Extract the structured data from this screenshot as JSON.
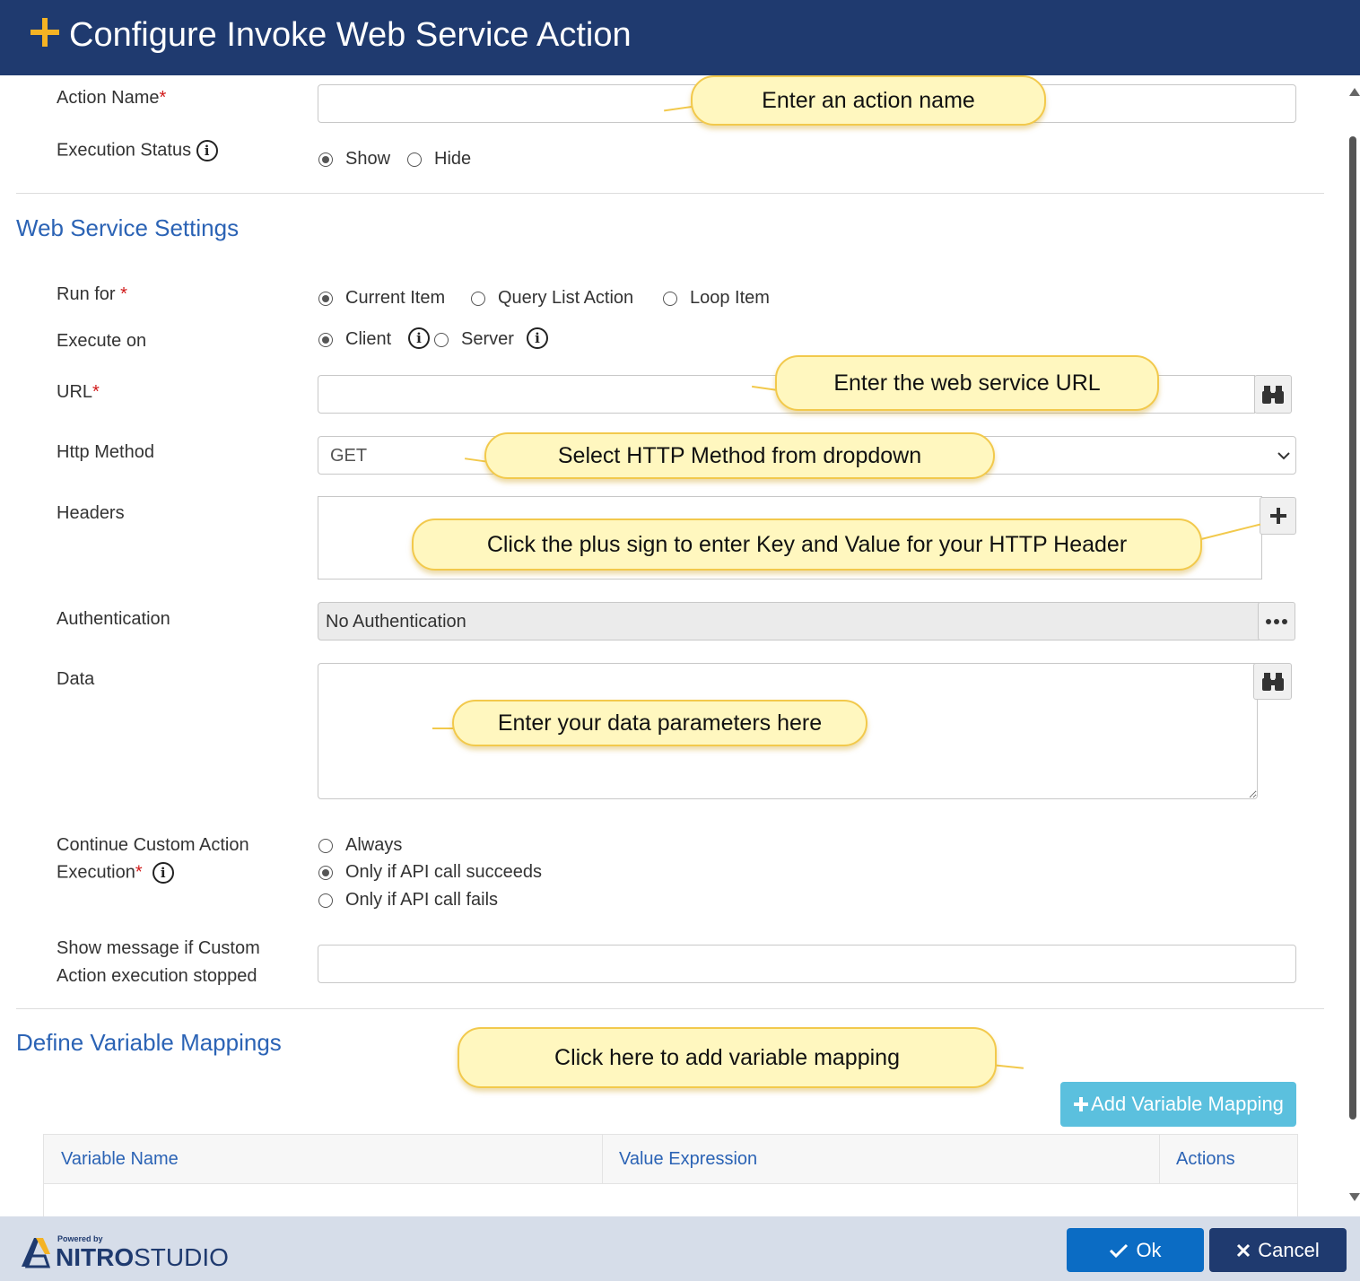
{
  "dialog": {
    "title": "Configure Invoke Web Service Action"
  },
  "action": {
    "name_label": "Action Name",
    "name_value": "",
    "status_label": "Execution Status",
    "status_options": [
      "Show",
      "Hide"
    ],
    "status_selected": "Show"
  },
  "web_service": {
    "section_title": "Web Service Settings",
    "run_for_label": "Run for",
    "run_for_options": [
      "Current Item",
      "Query List Action",
      "Loop Item"
    ],
    "run_for_selected": "Current Item",
    "execute_on_label": "Execute on",
    "execute_on_options": [
      "Client",
      "Server"
    ],
    "execute_on_selected": "Client",
    "url_label": "URL",
    "url_value": "",
    "http_method_label": "Http Method",
    "http_method_value": "GET",
    "headers_label": "Headers",
    "auth_label": "Authentication",
    "auth_value": "No Authentication",
    "data_label": "Data",
    "data_value": "",
    "continue_label_1": "Continue Custom Action",
    "continue_label_2": "Execution",
    "continue_options": [
      "Always",
      "Only if API call succeeds",
      "Only if API call fails"
    ],
    "continue_selected": "Only if API call succeeds",
    "message_label_1": "Show message if Custom",
    "message_label_2": "Action execution stopped",
    "message_value": ""
  },
  "mappings": {
    "section_title": "Define Variable Mappings",
    "add_button": "Add Variable Mapping",
    "columns": [
      "Variable Name",
      "Value Expression",
      "Actions"
    ]
  },
  "callouts": {
    "action_name": "Enter an action name",
    "url": "Enter the web service URL",
    "http_method": "Select HTTP Method from dropdown",
    "headers": "Click the plus sign to enter Key and Value for your HTTP Header",
    "data": "Enter your data parameters here",
    "mapping": "Click here to add variable mapping"
  },
  "footer": {
    "powered_by": "Powered by",
    "brand_1": "NITRO",
    "brand_2": "STUDIO",
    "ok": "Ok",
    "cancel": "Cancel"
  },
  "colors": {
    "header": "#1f3a6f",
    "accent": "#f5b324",
    "section_title": "#2b63b5",
    "required": "#d01919",
    "add_button": "#5bc0de",
    "ok_button": "#0b6cc4",
    "cancel_button": "#1f3a6f",
    "callout_fill": "#fff7bf",
    "footer": "#d6dde9"
  }
}
